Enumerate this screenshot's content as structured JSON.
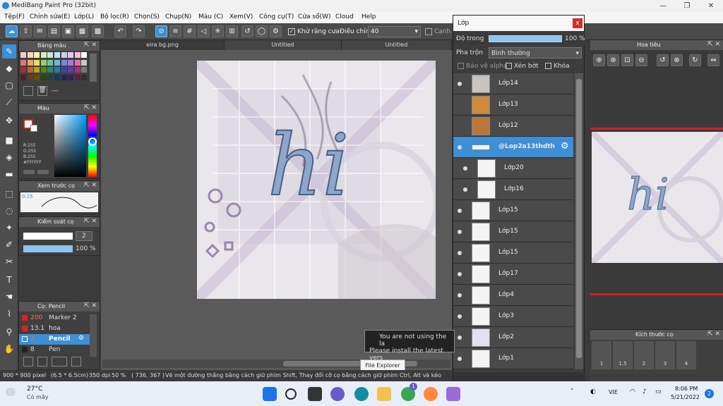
{
  "window": {
    "title": "MediBang Paint Pro (32bit)"
  },
  "menu": [
    "Tệp(F)",
    "Chỉnh sửa(E)",
    "Lớp(L)",
    "Bộ lọc(R)",
    "Chọn(S)",
    "Chụp(N)",
    "Màu (C)",
    "Xem(V)",
    "Công cụ(T)",
    "Cửa sổ(W)",
    "Cloud",
    "Help"
  ],
  "toolbar": {
    "antialias_label": "Khử răng cưa",
    "adjust_label": "Điều chỉnh",
    "adjust_value": "40",
    "edge_label": "Cạnh m"
  },
  "palette_panel": {
    "title": "Bảng màu",
    "dash": "---"
  },
  "color_panel": {
    "title": "Màu",
    "r": "R:255",
    "g": "G:255",
    "b": "B:255",
    "hex": "#FFFFFF"
  },
  "preview_panel": {
    "title": "Xem trước cọ",
    "size": "0.15"
  },
  "brush_ctrl": {
    "title": "Kiểm soát cọ",
    "size_value": "2",
    "opacity": "100 %"
  },
  "brush_list": {
    "title": "Cọ: Pencil",
    "items": [
      {
        "size": "200",
        "name": "Marker 2"
      },
      {
        "size": "13.1",
        "name": "hoa"
      },
      {
        "size": "2",
        "name": "Pencil"
      },
      {
        "size": "8",
        "name": "Pen"
      }
    ]
  },
  "tabs": [
    "eira bg.png",
    "Untitled",
    "Untitled"
  ],
  "status": {
    "dims": "900 * 900 pixel",
    "cm": "(6.5 * 6.5cm)",
    "dpi": "350 dpi",
    "zoom": "50 %",
    "coords": "( 736, 367 )",
    "hint": "Vẽ một đường thẳng bằng cách giữ phím Shift, Thay đổi cỡ cọ bằng cách giữ phím Ctrl, Alt và kéo"
  },
  "layers": {
    "title": "Lớp",
    "opacity_label": "Độ trong",
    "opacity_value": "100 %",
    "blend_label": "Pha trộn",
    "blend_value": "Bình thường",
    "protect_alpha": "Bảo vệ alpha",
    "clipping": "Xén bớt",
    "lock": "Khóa",
    "items": [
      "Lớp14",
      "Lớp13",
      "Lớp12",
      "@Lop2a13thdth",
      "Lớp20",
      "Lớp16",
      "Lớp15",
      "Lớp15",
      "Lớp15",
      "Lớp17",
      "Lớp4",
      "Lớp3",
      "Lớp2",
      "Lớp1"
    ]
  },
  "navigator": {
    "title": "Hoa tiêu"
  },
  "brush_size": {
    "title": "Kích thước cọ",
    "sizes": [
      "1",
      "1.5",
      "2",
      "3",
      "4"
    ]
  },
  "notification": {
    "line1": "You are not using the la",
    "line2": "Please install the latest vers"
  },
  "tooltip": "File Explorer",
  "taskbar": {
    "temp": "27°C",
    "weather": "Có mây",
    "lang": "VIE",
    "time": "8:06 PM",
    "date": "5/21/2022",
    "badge": "2",
    "chrome_badge": "1"
  },
  "canvas_text": "hi"
}
